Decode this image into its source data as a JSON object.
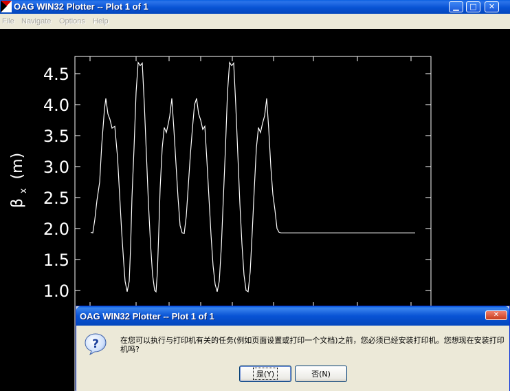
{
  "window": {
    "title": "OAG WIN32 Plotter -- Plot 1 of 1",
    "minimize_glyph": "▁",
    "maximize_glyph": "□",
    "close_glyph": "✕"
  },
  "menu": [
    "File",
    "Navigate",
    "Options",
    "Help"
  ],
  "chart_data": {
    "type": "line",
    "title": "",
    "xlabel": "",
    "ylabel": "βx (m)",
    "ylabel_symbol": "β",
    "ylabel_subscript": "x",
    "ylabel_unit": "(m)",
    "ylim": [
      0.85,
      4.9
    ],
    "yticks": [
      1.0,
      1.5,
      2.0,
      2.5,
      3.0,
      3.5,
      4.0,
      4.5
    ],
    "ytick_labels": [
      "1.0",
      "1.5",
      "2.0",
      "2.5",
      "3.0",
      "3.5",
      "4.0",
      "4.5"
    ],
    "grid": false,
    "background": "#000000",
    "line_color": "#ffffff",
    "series": [
      {
        "x": [
          0,
          3,
          6,
          9,
          13,
          16,
          20,
          22,
          25,
          28,
          31,
          35,
          39,
          42,
          45,
          48,
          50,
          53,
          56,
          58,
          60,
          63,
          66,
          69,
          72,
          75,
          78,
          81,
          84,
          87,
          90,
          93,
          95,
          97,
          99,
          101,
          104,
          107,
          110,
          113,
          115,
          118,
          121,
          124,
          127,
          130,
          133,
          136,
          139,
          142,
          145,
          148,
          151,
          154,
          157,
          160,
          163,
          166,
          169,
          172,
          175,
          178,
          181,
          184,
          187,
          190,
          193,
          196,
          199,
          202,
          205,
          208,
          211,
          214,
          217,
          220,
          223,
          226,
          229,
          232,
          235,
          238,
          241,
          244,
          247,
          250,
          253,
          256,
          259,
          262,
          265,
          268,
          271,
          274,
          277,
          280,
          283,
          286,
          289,
          292,
          295,
          298,
          301,
          304,
          307,
          310,
          313,
          316,
          319,
          322,
          325,
          328,
          331,
          334,
          337,
          340,
          343,
          346,
          349,
          352,
          355,
          358,
          361,
          364,
          367,
          370,
          373,
          376,
          379,
          382,
          385,
          388,
          391,
          394,
          397,
          400,
          403,
          406,
          409,
          412,
          415,
          418,
          421,
          424,
          427,
          430,
          433,
          436,
          439,
          442,
          445,
          448,
          451,
          454,
          457,
          460,
          463,
          466,
          469,
          472
        ],
        "y": [
          1.94,
          1.93,
          2.15,
          2.45,
          2.75,
          3.35,
          3.93,
          4.1,
          3.85,
          3.76,
          3.62,
          3.65,
          3.15,
          2.55,
          1.95,
          1.45,
          1.15,
          0.98,
          1.15,
          1.7,
          2.5,
          3.3,
          4.2,
          4.68,
          4.63,
          4.67,
          4.0,
          3.2,
          2.4,
          1.75,
          1.25,
          1.0,
          0.98,
          1.3,
          1.95,
          2.65,
          3.3,
          3.63,
          3.55,
          3.7,
          3.82,
          4.1,
          3.6,
          3.05,
          2.5,
          2.05,
          1.93,
          1.92,
          2.2,
          2.7,
          3.2,
          3.62,
          4.0,
          4.1,
          3.85,
          3.75,
          3.6,
          3.65,
          3.1,
          2.5,
          1.9,
          1.4,
          1.1,
          0.98,
          1.15,
          1.7,
          2.5,
          3.3,
          4.2,
          4.68,
          4.63,
          4.67,
          4.0,
          3.2,
          2.4,
          1.75,
          1.25,
          1.0,
          0.98,
          1.3,
          1.95,
          2.65,
          3.3,
          3.63,
          3.55,
          3.7,
          3.82,
          4.1,
          3.6,
          3.0,
          2.55,
          2.3,
          2.0,
          1.94,
          1.93,
          1.93,
          1.93,
          1.93,
          1.93,
          1.93,
          1.93,
          1.93,
          1.93,
          1.93,
          1.93,
          1.93,
          1.93,
          1.93,
          1.93,
          1.93,
          1.93,
          1.93,
          1.93,
          1.93,
          1.93,
          1.93,
          1.93,
          1.93,
          1.93,
          1.93,
          1.93,
          1.93,
          1.93,
          1.93,
          1.93,
          1.93,
          1.93,
          1.93,
          1.93,
          1.93,
          1.93,
          1.93,
          1.93,
          1.93,
          1.93,
          1.93,
          1.93,
          1.93,
          1.93,
          1.93,
          1.93,
          1.93,
          1.93,
          1.93,
          1.93,
          1.93,
          1.93,
          1.93,
          1.93,
          1.93,
          1.93,
          1.93,
          1.93,
          1.93,
          1.93,
          1.93,
          1.93,
          1.93,
          1.93,
          1.93
        ]
      }
    ]
  },
  "dialog": {
    "title": "OAG WIN32 Plotter -- Plot 1 of 1",
    "close_glyph": "✕",
    "message": "在您可以执行与打印机有关的任务(例如页面设置或打印一个文档)之前，您必须已经安装打印机。您想现在安装打印机吗?",
    "yes_label": "是(Y)",
    "no_label": "否(N)"
  }
}
